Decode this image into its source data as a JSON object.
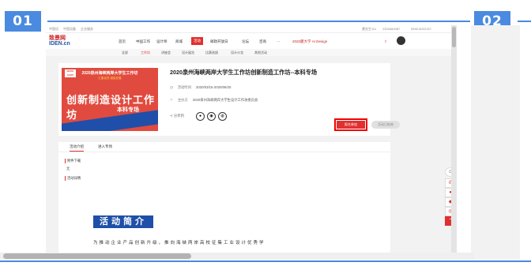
{
  "steps": [
    "01",
    "02"
  ],
  "site": {
    "topbar": {
      "left": [
        "中国设",
        "中国设备",
        "企业服务"
      ],
      "right": [
        "黄先生111",
        "1303460087",
        "0592-6022157"
      ]
    },
    "logo": {
      "top": "致景网",
      "bottom": "IDEN.cn"
    },
    "nav": [
      "首页",
      "中国工作",
      "设计师",
      "商城",
      "活动",
      "邮政开放日",
      "论坛",
      "咨询",
      "···",
      "2020厦大学 AI Design"
    ],
    "subnav": [
      "全部",
      "工作坊",
      "讲座会",
      "设计展览",
      "比赛选拔",
      "设计沙龙",
      "其他活动"
    ]
  },
  "card": {
    "banner": {
      "logo": "MAKE SHOP",
      "line1": "2020泉州海峡两岸大学生工作坊",
      "line2": "汇集创意 赋能发展",
      "headline": "创新制造设计工作坊",
      "sub": "本科专场"
    },
    "title": "2020泉州海峡两岸大学生工作坊创新制造工作坊--本科专场",
    "time_label": "活动时间",
    "time_value": "2020/03/15-2020/06/20",
    "org_label": "主办方",
    "org_value": "2020泉州海峡两岸大学生设计工作坊委员会",
    "share_label": "分享到",
    "share_icons": [
      "wechat-icon",
      "weibo-icon",
      "qq-icon"
    ],
    "register_button": "报名参加",
    "closed_button": "活动已结束"
  },
  "tabs": [
    "活动介绍",
    "进入专场"
  ],
  "content": {
    "attach_label": "附件下载",
    "attach_value": "无",
    "detail_label": "活动详情",
    "section_title": "活动简介",
    "paragraph": "为推动企业产品创新升级，推向海峡两岸高校征集工业设计优秀学"
  },
  "sidebar_icons": [
    "service-icon",
    "phone-icon",
    "chat-icon",
    "bell-icon",
    "wechat-icon",
    "scroll-top-icon"
  ],
  "colors": {
    "accent": "#4a8ae0",
    "brand_red": "#e03030",
    "brand_blue": "#1f4fa8"
  }
}
